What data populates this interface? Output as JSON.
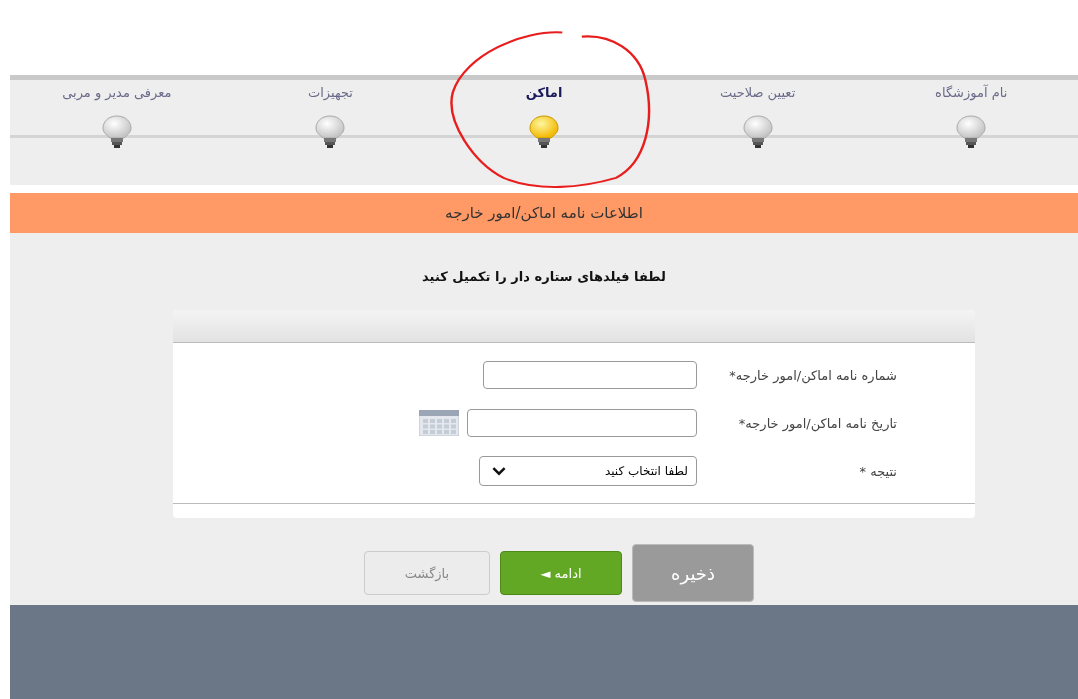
{
  "steps": [
    {
      "label": "نام آموزشگاه",
      "selected": false
    },
    {
      "label": "تعیین صلاحیت",
      "selected": false
    },
    {
      "label": "اماکن",
      "selected": true
    },
    {
      "label": "تجهیزات",
      "selected": false
    },
    {
      "label": "معرفی مدیر و مربی",
      "selected": false
    }
  ],
  "section_title": "اطلاعات نامه اماکن/امور خارجه",
  "instruction": "لطفا فیلدهای ستاره دار را تکمیل کنید",
  "fields": [
    {
      "kind": "text",
      "label": "شماره نامه اماکن/امور خارجه*"
    },
    {
      "kind": "date",
      "label": "تاریخ نامه اماکن/امور خارجه*"
    },
    {
      "kind": "select",
      "label": "نتیجه *",
      "value": "لطفا انتخاب کنید"
    }
  ],
  "buttons": [
    {
      "kind": "save",
      "label": "ذخیره"
    },
    {
      "kind": "next",
      "label": "ادامه ◄"
    },
    {
      "kind": "back",
      "label": "بازگشت"
    }
  ]
}
